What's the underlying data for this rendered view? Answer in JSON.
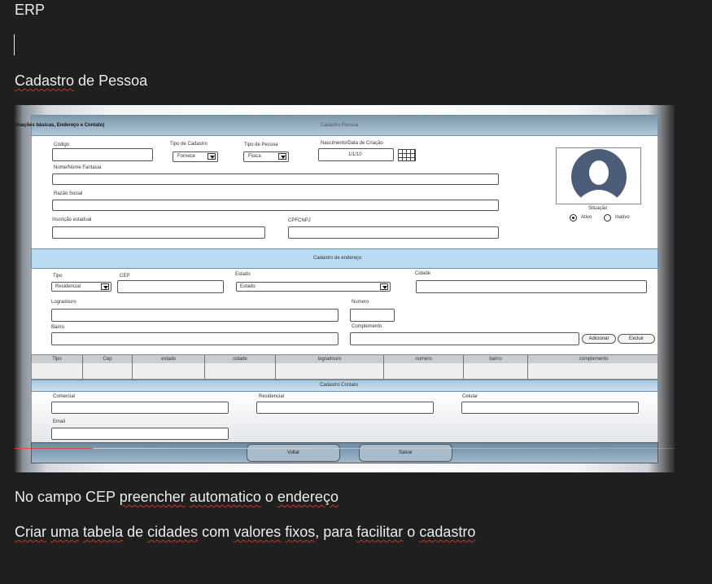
{
  "doc": {
    "title": "ERP",
    "heading_part1": "Cadastro",
    "heading_part2": " de Pessoa",
    "note1": {
      "p1": "No campo CEP ",
      "p2": "preencher",
      "p3": " ",
      "p4": "automatico",
      "p5": " o ",
      "p6": "endereço"
    },
    "note2": {
      "p1": "Criar",
      "p2": " ",
      "p3": "uma",
      "p4": " ",
      "p5": "tabela",
      "p6": " de ",
      "p7": "cidades",
      "p8": " com ",
      "p9": "valores",
      "p10": " ",
      "p11": "fixos",
      "p12": ", para ",
      "p13": "facilitar",
      "p14": " o ",
      "p15": "cadastro"
    }
  },
  "mockup": {
    "topbar": {
      "left": "rmações básicas, Endereço e Contato)",
      "center": "Cadastro Pessoa"
    },
    "basic": {
      "codigo_label": "Código",
      "tipo_cadastro_label": "Tipo de Cadastro",
      "tipo_cadastro_value": "Fornece",
      "tipo_pessoa_label": "Tipo de Pessoa",
      "tipo_pessoa_value": "Fisica",
      "nascimento_label": "Nascimento/Data de Criação",
      "nascimento_value": "1/1/10",
      "nome_label": "Nome/Nome Fantasia",
      "razao_label": "Razão Social",
      "inscricao_label": "Inscrição estadual",
      "cpf_label": "CPFCNPJ",
      "situacao_label": "Situação",
      "ativo_label": "Ativo",
      "inativo_label": "Inativo"
    },
    "address": {
      "band_title": "Cadastro de endereço",
      "tipo_label": "Tipo",
      "tipo_value": "Residencial",
      "cep_label": "CEP",
      "estado_label": "Estado",
      "estado_value": "Estado",
      "cidade_label": "Cidade",
      "logradouro_label": "Logradouro",
      "numero_label": "Numero",
      "bairro_label": "Bairro",
      "complemento_label": "Complemento",
      "adicionar_label": "Adicionar",
      "excluir_label": "Excluir",
      "columns": [
        "Tipo",
        "Cep",
        "estado",
        "cidade",
        "logradouro",
        "numero",
        "bairro",
        "complemento"
      ]
    },
    "contact": {
      "band_title": "Cadastro Contato",
      "comercial_label": "Comercial",
      "residencial_label": "Residencial",
      "celular_label": "Celular",
      "email_label": "Email"
    },
    "footer": {
      "voltar_label": "Voltar",
      "salvar_label": "Salvar"
    }
  }
}
